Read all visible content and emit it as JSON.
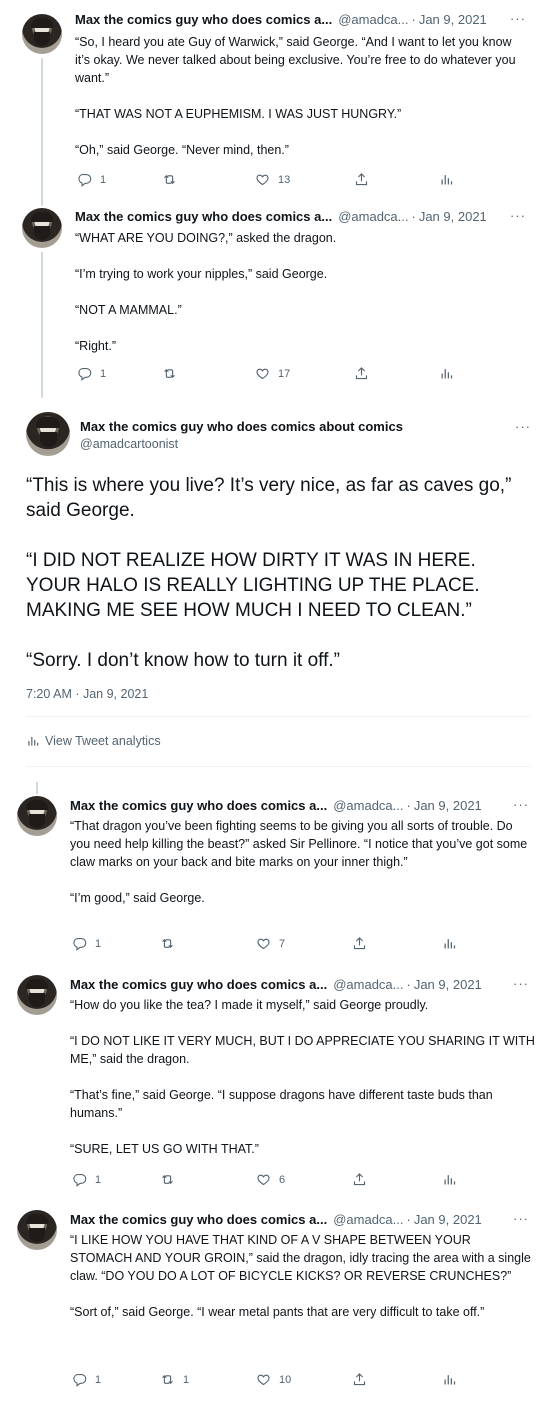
{
  "author": {
    "name_truncated": "Max the comics guy who does comics a...",
    "name_full": "Max the comics guy who does comics about comics",
    "handle_truncated": "@amadca...",
    "handle_full": "@amadcartoonist"
  },
  "icons": {
    "reply": "reply-icon",
    "retweet": "retweet-icon",
    "like": "heart-icon",
    "share": "share-icon",
    "analytics": "analytics-icon",
    "more": "more-icon"
  },
  "more_glyph": "···",
  "date_separator": "·",
  "tweets": [
    {
      "date": "Jan 9, 2021",
      "paragraphs": [
        "“So, I heard you ate Guy of Warwick,” said George. “And I want to let you know it’s okay. We never talked about being exclusive. You’re free to do whatever you want.”",
        "“THAT WAS NOT A EUPHEMISM. I WAS JUST HUNGRY.”",
        "“Oh,” said George. “Never mind, then.”"
      ],
      "replies": "1",
      "retweets": "",
      "likes": "13"
    },
    {
      "date": "Jan 9, 2021",
      "paragraphs": [
        "“WHAT ARE YOU DOING?,” asked the dragon.",
        "“I’m trying to work your nipples,” said George.",
        "“NOT A MAMMAL.”",
        "“Right.”"
      ],
      "replies": "1",
      "retweets": "",
      "likes": "17"
    }
  ],
  "main_tweet": {
    "paragraphs": [
      "“This is where you live? It’s very nice, as far as caves go,” said George.",
      "“I DID NOT REALIZE HOW DIRTY IT WAS IN HERE. YOUR HALO IS REALLY LIGHTING UP THE PLACE. MAKING ME SEE HOW MUCH I NEED TO CLEAN.”",
      "“Sorry. I don’t know how to turn it off.”"
    ],
    "timestamp": "7:20 AM · Jan 9, 2021",
    "analytics_label": "View Tweet analytics"
  },
  "replies_below": [
    {
      "date": "Jan 9, 2021",
      "paragraphs": [
        "“That dragon you’ve been fighting seems to be giving you all sorts of trouble. Do you need help killing the beast?” asked Sir Pellinore. “I notice that you’ve got some claw marks on your back and bite marks on your inner thigh.”",
        "“I’m good,” said George."
      ],
      "replies": "1",
      "retweets": "",
      "likes": "7"
    },
    {
      "date": "Jan 9, 2021",
      "paragraphs": [
        "“How do you like the tea? I made it myself,” said George proudly.",
        "“I DO NOT LIKE IT VERY MUCH, BUT I DO APPRECIATE YOU SHARING IT WITH ME,” said the dragon.",
        "“That’s fine,” said George. “I suppose dragons have different taste buds than humans.”",
        "“SURE, LET US GO WITH THAT.”"
      ],
      "replies": "1",
      "retweets": "",
      "likes": "6"
    },
    {
      "date": "Jan 9, 2021",
      "paragraphs": [
        "“I LIKE HOW YOU HAVE THAT KIND OF A V SHAPE BETWEEN YOUR STOMACH AND YOUR GROIN,” said the dragon, idly tracing the area with a single claw. “DO YOU DO A LOT OF BICYCLE KICKS? OR REVERSE CRUNCHES?”",
        "“Sort of,” said George. “I wear metal pants that are very difficult to take off.”"
      ],
      "replies": "1",
      "retweets": "1",
      "likes": "10"
    }
  ]
}
